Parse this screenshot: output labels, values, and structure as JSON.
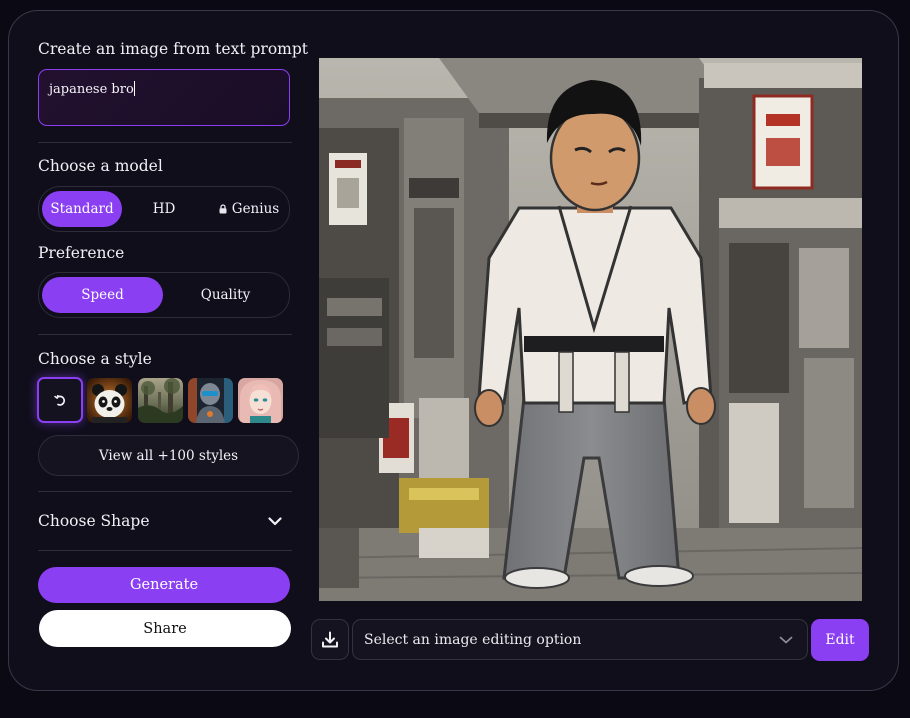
{
  "prompt": {
    "heading": "Create an image from text prompt",
    "value": "japanese bro"
  },
  "model": {
    "heading": "Choose a model",
    "options": [
      "Standard",
      "HD",
      "Genius"
    ],
    "selected": "Standard",
    "locked": "Genius"
  },
  "preference": {
    "heading": "Preference",
    "options": [
      "Speed",
      "Quality"
    ],
    "selected": "Speed"
  },
  "style": {
    "heading": "Choose a style",
    "thumbnails": [
      "no-style",
      "panda",
      "forest",
      "robot",
      "portrait"
    ],
    "view_all": "View all +100 styles"
  },
  "shape": {
    "heading": "Choose Shape"
  },
  "actions": {
    "generate": "Generate",
    "share": "Share"
  },
  "editor": {
    "select_placeholder": "Select an image editing option",
    "edit": "Edit"
  },
  "colors": {
    "accent": "#8b3ff2",
    "background": "#100e1b"
  },
  "icons": [
    "lock-icon",
    "chevron-down-icon",
    "download-icon",
    "no-style-icon"
  ]
}
